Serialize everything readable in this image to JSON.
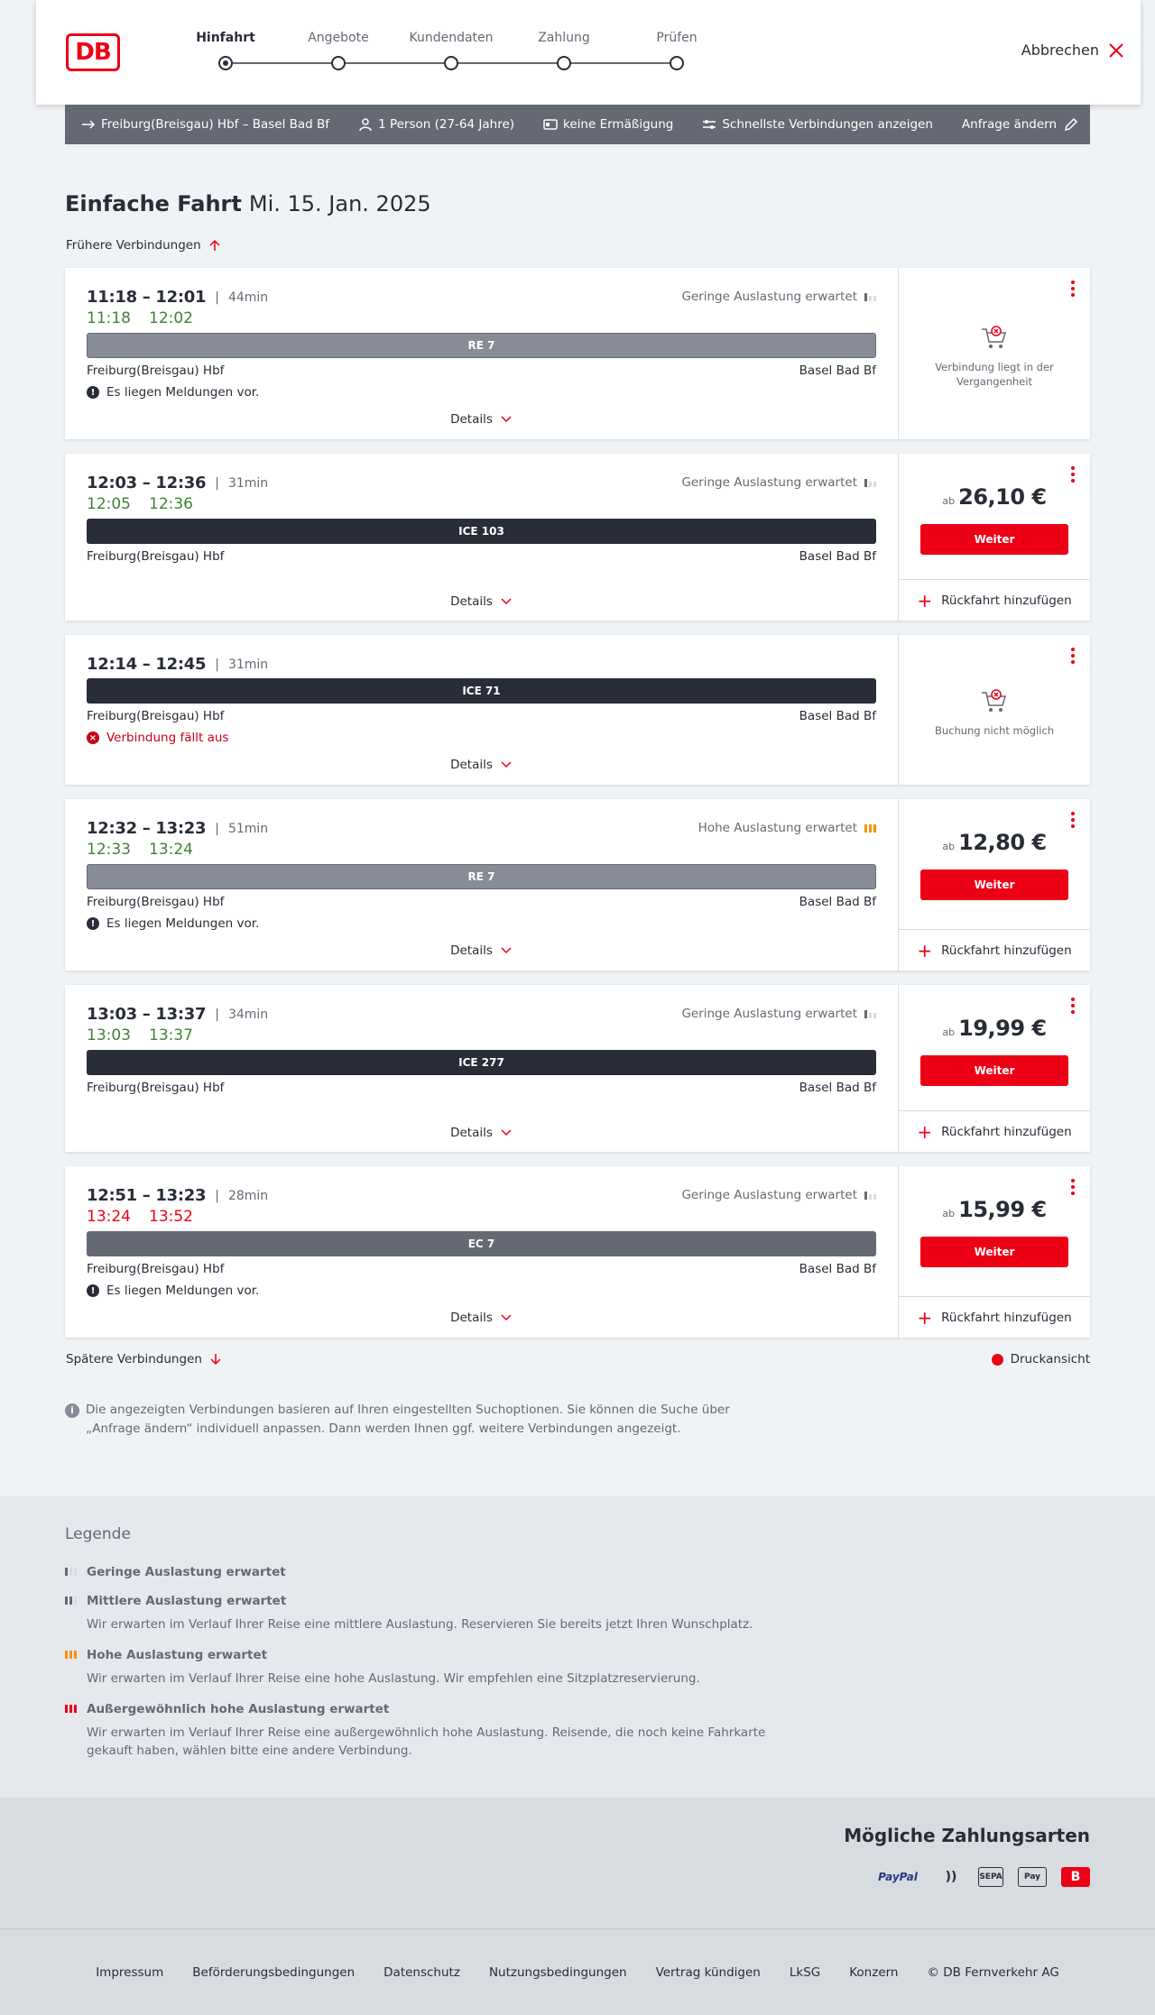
{
  "header": {
    "logo": "DB",
    "steps": [
      {
        "label": "Hinfahrt",
        "active": true
      },
      {
        "label": "Angebote",
        "active": false
      },
      {
        "label": "Kundendaten",
        "active": false
      },
      {
        "label": "Zahlung",
        "active": false
      },
      {
        "label": "Prüfen",
        "active": false
      }
    ],
    "cancel_label": "Abbrechen"
  },
  "search": {
    "route": "Freiburg(Breisgau) Hbf – Basel Bad Bf",
    "passengers": "1 Person (27-64 Jahre)",
    "discount": "keine Ermäßigung",
    "fastest": "Schnellste Verbindungen anzeigen",
    "change": "Anfrage ändern"
  },
  "page": {
    "title": "Einfache Fahrt",
    "date": "Mi. 15. Jan. 2025",
    "earlier": "Frühere Verbindungen",
    "later": "Spätere Verbindungen",
    "print": "Druckansicht",
    "info": "Die angezeigten Verbindungen basieren auf Ihren eingestellten Suchoptionen. Sie können die Suche über „Anfrage ändern“ individuell anpassen. Dann werden Ihnen ggf. weitere Verbindungen angezeigt."
  },
  "labels": {
    "details": "Details",
    "weiter": "Weiter",
    "ab": "ab",
    "return": "Rückfahrt hinzufügen"
  },
  "connections": [
    {
      "time": "11:18 – 12:01",
      "duration": "44min",
      "rt_dep": "11:18",
      "rt_arr": "12:02",
      "rt_color": "green",
      "occupancy": "Geringe Auslastung erwartet",
      "occ_level": "low",
      "train": "RE 7",
      "train_type": "re",
      "from": "Freiburg(Breisgau) Hbf",
      "to": "Basel Bad Bf",
      "message": "Es liegen Meldungen vor.",
      "msg_type": "info",
      "status": "past",
      "status_text": "Verbindung liegt in der Vergangenheit"
    },
    {
      "time": "12:03 – 12:36",
      "duration": "31min",
      "rt_dep": "12:05",
      "rt_arr": "12:36",
      "rt_color": "green",
      "occupancy": "Geringe Auslastung erwartet",
      "occ_level": "low",
      "train": "ICE 103",
      "train_type": "ice",
      "from": "Freiburg(Breisgau) Hbf",
      "to": "Basel Bad Bf",
      "message": "",
      "msg_type": "",
      "status": "bookable",
      "price": "26,10 €"
    },
    {
      "time": "12:14 – 12:45",
      "duration": "31min",
      "rt_dep": "",
      "rt_arr": "",
      "rt_color": "",
      "occupancy": "",
      "occ_level": "",
      "train": "ICE 71",
      "train_type": "ice",
      "from": "Freiburg(Breisgau) Hbf",
      "to": "Basel Bad Bf",
      "message": "Verbindung fällt aus",
      "msg_type": "cancelled",
      "status": "unbookable",
      "status_text": "Buchung nicht möglich"
    },
    {
      "time": "12:32 – 13:23",
      "duration": "51min",
      "rt_dep": "12:33",
      "rt_arr": "13:24",
      "rt_color": "green",
      "occupancy": "Hohe Auslastung erwartet",
      "occ_level": "high",
      "train": "RE 7",
      "train_type": "re",
      "from": "Freiburg(Breisgau) Hbf",
      "to": "Basel Bad Bf",
      "message": "Es liegen Meldungen vor.",
      "msg_type": "info",
      "status": "bookable",
      "price": "12,80 €"
    },
    {
      "time": "13:03 – 13:37",
      "duration": "34min",
      "rt_dep": "13:03",
      "rt_arr": "13:37",
      "rt_color": "green",
      "occupancy": "Geringe Auslastung erwartet",
      "occ_level": "low",
      "train": "ICE 277",
      "train_type": "ice",
      "from": "Freiburg(Breisgau) Hbf",
      "to": "Basel Bad Bf",
      "message": "",
      "msg_type": "",
      "status": "bookable",
      "price": "19,99 €"
    },
    {
      "time": "12:51 – 13:23",
      "duration": "28min",
      "rt_dep": "13:24",
      "rt_arr": "13:52",
      "rt_color": "red",
      "occupancy": "Geringe Auslastung erwartet",
      "occ_level": "low",
      "train": "EC 7",
      "train_type": "ec",
      "from": "Freiburg(Breisgau) Hbf",
      "to": "Basel Bad Bf",
      "message": "Es liegen Meldungen vor.",
      "msg_type": "info",
      "status": "bookable",
      "price": "15,99 €"
    }
  ],
  "legend": {
    "title": "Legende",
    "items": [
      {
        "level": "low",
        "title": "Geringe Auslastung erwartet",
        "desc": ""
      },
      {
        "level": "mid",
        "title": "Mittlere Auslastung erwartet",
        "desc": "Wir erwarten im Verlauf Ihrer Reise eine mittlere Auslastung. Reservieren Sie bereits jetzt Ihren Wunschplatz."
      },
      {
        "level": "high",
        "title": "Hohe Auslastung erwartet",
        "desc": "Wir erwarten im Verlauf Ihrer Reise eine hohe Auslastung. Wir empfehlen eine Sitzplatzreservierung."
      },
      {
        "level": "xhigh",
        "title": "Außergewöhnlich hohe Auslastung erwartet",
        "desc": "Wir erwarten im Verlauf Ihrer Reise eine außergewöhnlich hohe Auslastung. Reisende, die noch keine Fahrkarte gekauft haben, wählen bitte eine andere Verbindung."
      }
    ]
  },
  "payment": {
    "title": "Mögliche Zahlungsarten",
    "methods": [
      {
        "name": "paypal-icon",
        "text": "PayPal"
      },
      {
        "name": "contactless-icon",
        "text": "))"
      },
      {
        "name": "sepa-icon",
        "text": "SEPA"
      },
      {
        "name": "apple-pay-icon",
        "text": "Pay"
      },
      {
        "name": "db-card-icon",
        "text": "B"
      }
    ]
  },
  "footer": {
    "links": [
      "Impressum",
      "Beförderungsbedingungen",
      "Datenschutz",
      "Nutzungsbedingungen",
      "Vertrag kündigen",
      "LkSG",
      "Konzern",
      "© DB Fernverkehr AG"
    ]
  },
  "colors": {
    "brand_red": "#ec0016",
    "on_time_green": "#408335",
    "high_load_orange": "#f39200",
    "dark": "#282d37"
  }
}
